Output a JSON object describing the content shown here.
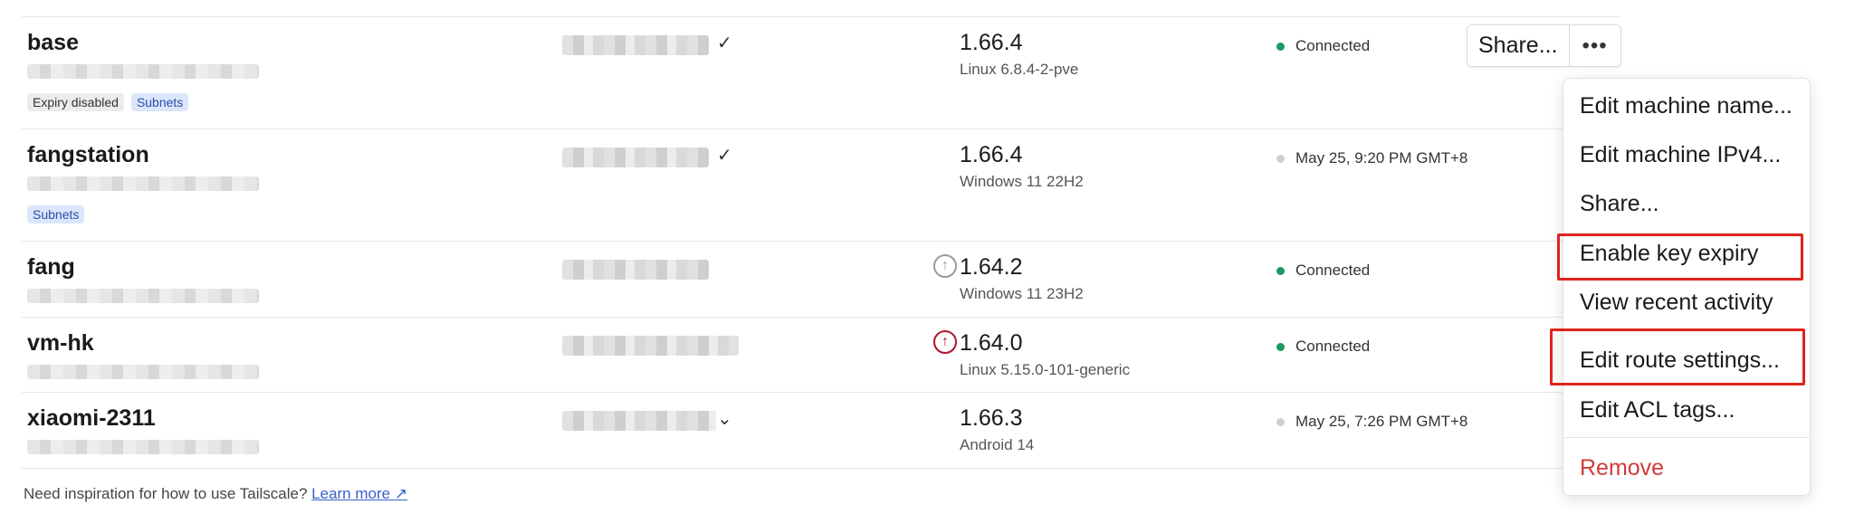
{
  "devices": [
    {
      "name": "base",
      "tags": [
        "Expiry disabled",
        "Subnets"
      ],
      "version": "1.66.4",
      "os": "Linux 6.8.4-2-pve",
      "status": "Connected",
      "status_kind": "connected",
      "update": "none",
      "chevron": "✓"
    },
    {
      "name": "fangstation",
      "tags": [
        "Subnets"
      ],
      "version": "1.66.4",
      "os": "Windows 11 22H2",
      "status": "May 25, 9:20 PM GMT+8",
      "status_kind": "offline",
      "update": "none",
      "chevron": "✓"
    },
    {
      "name": "fang",
      "tags": [],
      "version": "1.64.2",
      "os": "Windows 11 23H2",
      "status": "Connected",
      "status_kind": "connected",
      "update": "available",
      "chevron": ""
    },
    {
      "name": "vm-hk",
      "tags": [],
      "version": "1.64.0",
      "os": "Linux 5.15.0-101-generic",
      "status": "Connected",
      "status_kind": "connected",
      "update": "security",
      "chevron": ""
    },
    {
      "name": "xiaomi-2311",
      "tags": [],
      "version": "1.66.3",
      "os": "Android 14",
      "status": "May 25, 7:26 PM GMT+8",
      "status_kind": "offline",
      "update": "none",
      "chevron": "⌄"
    }
  ],
  "actions": {
    "share_label": "Share...",
    "more_icon": "•••"
  },
  "footer": {
    "text": "Need inspiration for how to use Tailscale?",
    "link": "Learn more ↗"
  },
  "menu": {
    "items": [
      "Edit machine name...",
      "Edit machine IPv4...",
      "Share...",
      "Enable key expiry",
      "View recent activity",
      "Edit route settings...",
      "Edit ACL tags...",
      "Remove"
    ],
    "highlighted": [
      "Enable key expiry",
      "Edit route settings..."
    ]
  },
  "colors": {
    "connected": "#1a9960",
    "offline": "#cfcfcf",
    "danger": "#d23a3a",
    "highlight": "#e0231d",
    "tag_blue_bg": "#dbe6fb"
  },
  "icons": {
    "update_available": "arrow-up-circle-icon",
    "update_security": "arrow-up-circle-red-icon",
    "more": "ellipsis-icon",
    "external": "external-link-icon"
  }
}
